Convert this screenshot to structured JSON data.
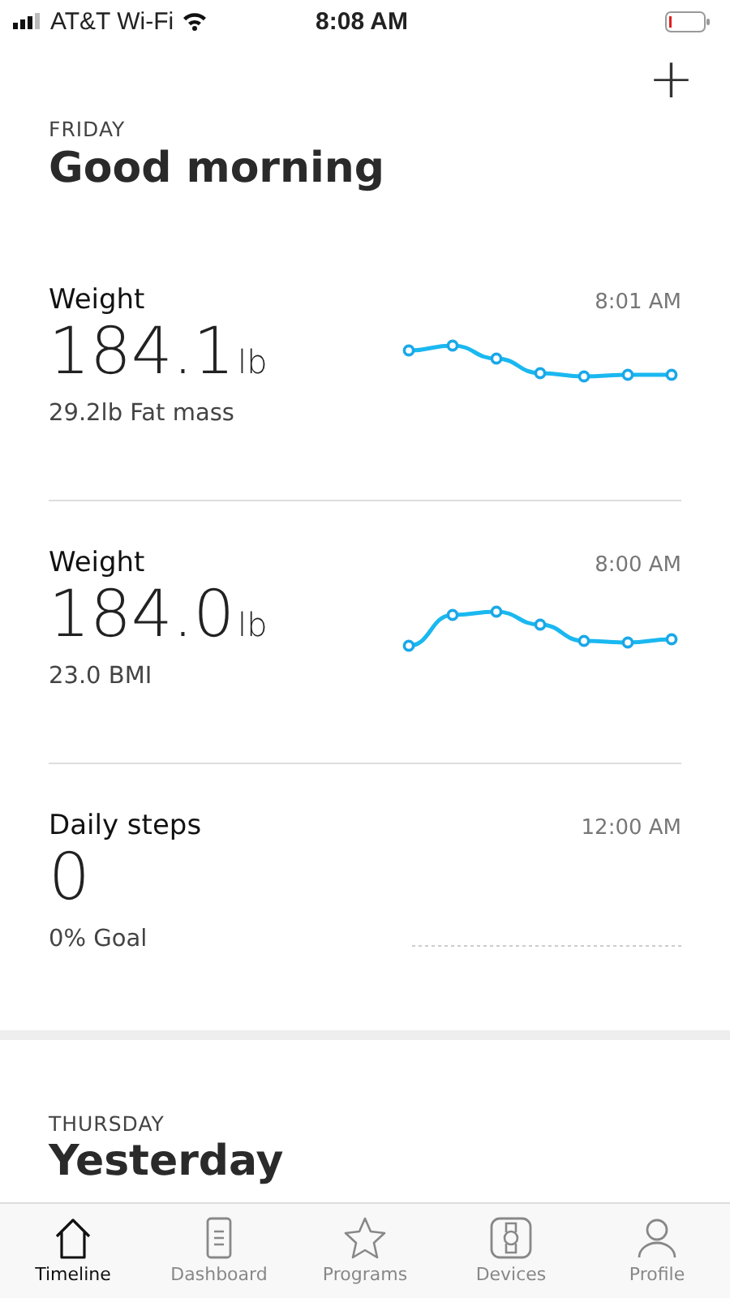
{
  "status_bar": {
    "carrier": "AT&T Wi-Fi",
    "time": "8:08 AM"
  },
  "header": {
    "add_icon": "+",
    "day": "FRIDAY",
    "greeting": "Good morning"
  },
  "cards": [
    {
      "title": "Weight",
      "time": "8:01 AM",
      "value": "184.1",
      "unit": "lb",
      "detail": "29.2lb Fat mass",
      "kind": "sparkline"
    },
    {
      "title": "Weight",
      "time": "8:00 AM",
      "value": "184.0",
      "unit": "lb",
      "detail": "23.0 BMI",
      "kind": "sparkline"
    },
    {
      "title": "Daily steps",
      "time": "12:00 AM",
      "value": "0",
      "detail": "0% Goal",
      "kind": "empty"
    }
  ],
  "next_section": {
    "day": "THURSDAY",
    "greeting": "Yesterday"
  },
  "tab_bar": [
    {
      "label": "Timeline",
      "selected": true
    },
    {
      "label": "Dashboard",
      "selected": false
    },
    {
      "label": "Programs",
      "selected": false
    },
    {
      "label": "Devices",
      "selected": false
    },
    {
      "label": "Profile",
      "selected": false
    }
  ]
}
